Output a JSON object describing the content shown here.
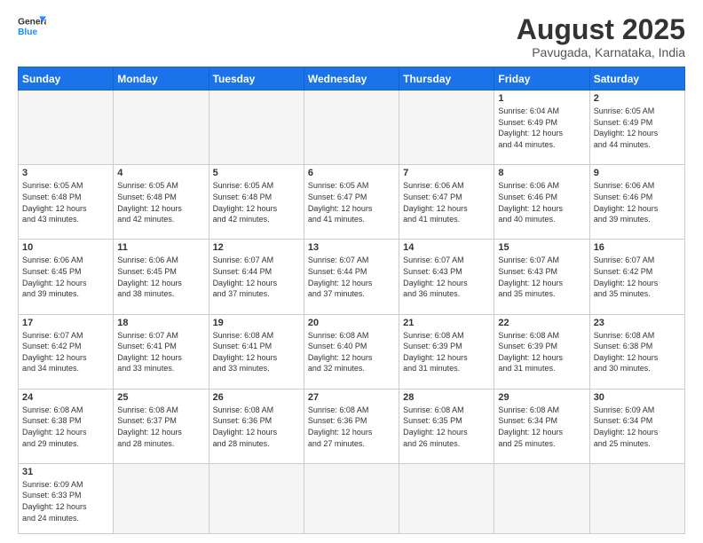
{
  "header": {
    "logo_general": "General",
    "logo_blue": "Blue",
    "month_title": "August 2025",
    "location": "Pavugada, Karnataka, India"
  },
  "weekdays": [
    "Sunday",
    "Monday",
    "Tuesday",
    "Wednesday",
    "Thursday",
    "Friday",
    "Saturday"
  ],
  "weeks": [
    [
      {
        "day": "",
        "info": ""
      },
      {
        "day": "",
        "info": ""
      },
      {
        "day": "",
        "info": ""
      },
      {
        "day": "",
        "info": ""
      },
      {
        "day": "",
        "info": ""
      },
      {
        "day": "1",
        "info": "Sunrise: 6:04 AM\nSunset: 6:49 PM\nDaylight: 12 hours\nand 44 minutes."
      },
      {
        "day": "2",
        "info": "Sunrise: 6:05 AM\nSunset: 6:49 PM\nDaylight: 12 hours\nand 44 minutes."
      }
    ],
    [
      {
        "day": "3",
        "info": "Sunrise: 6:05 AM\nSunset: 6:48 PM\nDaylight: 12 hours\nand 43 minutes."
      },
      {
        "day": "4",
        "info": "Sunrise: 6:05 AM\nSunset: 6:48 PM\nDaylight: 12 hours\nand 42 minutes."
      },
      {
        "day": "5",
        "info": "Sunrise: 6:05 AM\nSunset: 6:48 PM\nDaylight: 12 hours\nand 42 minutes."
      },
      {
        "day": "6",
        "info": "Sunrise: 6:05 AM\nSunset: 6:47 PM\nDaylight: 12 hours\nand 41 minutes."
      },
      {
        "day": "7",
        "info": "Sunrise: 6:06 AM\nSunset: 6:47 PM\nDaylight: 12 hours\nand 41 minutes."
      },
      {
        "day": "8",
        "info": "Sunrise: 6:06 AM\nSunset: 6:46 PM\nDaylight: 12 hours\nand 40 minutes."
      },
      {
        "day": "9",
        "info": "Sunrise: 6:06 AM\nSunset: 6:46 PM\nDaylight: 12 hours\nand 39 minutes."
      }
    ],
    [
      {
        "day": "10",
        "info": "Sunrise: 6:06 AM\nSunset: 6:45 PM\nDaylight: 12 hours\nand 39 minutes."
      },
      {
        "day": "11",
        "info": "Sunrise: 6:06 AM\nSunset: 6:45 PM\nDaylight: 12 hours\nand 38 minutes."
      },
      {
        "day": "12",
        "info": "Sunrise: 6:07 AM\nSunset: 6:44 PM\nDaylight: 12 hours\nand 37 minutes."
      },
      {
        "day": "13",
        "info": "Sunrise: 6:07 AM\nSunset: 6:44 PM\nDaylight: 12 hours\nand 37 minutes."
      },
      {
        "day": "14",
        "info": "Sunrise: 6:07 AM\nSunset: 6:43 PM\nDaylight: 12 hours\nand 36 minutes."
      },
      {
        "day": "15",
        "info": "Sunrise: 6:07 AM\nSunset: 6:43 PM\nDaylight: 12 hours\nand 35 minutes."
      },
      {
        "day": "16",
        "info": "Sunrise: 6:07 AM\nSunset: 6:42 PM\nDaylight: 12 hours\nand 35 minutes."
      }
    ],
    [
      {
        "day": "17",
        "info": "Sunrise: 6:07 AM\nSunset: 6:42 PM\nDaylight: 12 hours\nand 34 minutes."
      },
      {
        "day": "18",
        "info": "Sunrise: 6:07 AM\nSunset: 6:41 PM\nDaylight: 12 hours\nand 33 minutes."
      },
      {
        "day": "19",
        "info": "Sunrise: 6:08 AM\nSunset: 6:41 PM\nDaylight: 12 hours\nand 33 minutes."
      },
      {
        "day": "20",
        "info": "Sunrise: 6:08 AM\nSunset: 6:40 PM\nDaylight: 12 hours\nand 32 minutes."
      },
      {
        "day": "21",
        "info": "Sunrise: 6:08 AM\nSunset: 6:39 PM\nDaylight: 12 hours\nand 31 minutes."
      },
      {
        "day": "22",
        "info": "Sunrise: 6:08 AM\nSunset: 6:39 PM\nDaylight: 12 hours\nand 31 minutes."
      },
      {
        "day": "23",
        "info": "Sunrise: 6:08 AM\nSunset: 6:38 PM\nDaylight: 12 hours\nand 30 minutes."
      }
    ],
    [
      {
        "day": "24",
        "info": "Sunrise: 6:08 AM\nSunset: 6:38 PM\nDaylight: 12 hours\nand 29 minutes."
      },
      {
        "day": "25",
        "info": "Sunrise: 6:08 AM\nSunset: 6:37 PM\nDaylight: 12 hours\nand 28 minutes."
      },
      {
        "day": "26",
        "info": "Sunrise: 6:08 AM\nSunset: 6:36 PM\nDaylight: 12 hours\nand 28 minutes."
      },
      {
        "day": "27",
        "info": "Sunrise: 6:08 AM\nSunset: 6:36 PM\nDaylight: 12 hours\nand 27 minutes."
      },
      {
        "day": "28",
        "info": "Sunrise: 6:08 AM\nSunset: 6:35 PM\nDaylight: 12 hours\nand 26 minutes."
      },
      {
        "day": "29",
        "info": "Sunrise: 6:08 AM\nSunset: 6:34 PM\nDaylight: 12 hours\nand 25 minutes."
      },
      {
        "day": "30",
        "info": "Sunrise: 6:09 AM\nSunset: 6:34 PM\nDaylight: 12 hours\nand 25 minutes."
      }
    ],
    [
      {
        "day": "31",
        "info": "Sunrise: 6:09 AM\nSunset: 6:33 PM\nDaylight: 12 hours\nand 24 minutes."
      },
      {
        "day": "",
        "info": ""
      },
      {
        "day": "",
        "info": ""
      },
      {
        "day": "",
        "info": ""
      },
      {
        "day": "",
        "info": ""
      },
      {
        "day": "",
        "info": ""
      },
      {
        "day": "",
        "info": ""
      }
    ]
  ]
}
